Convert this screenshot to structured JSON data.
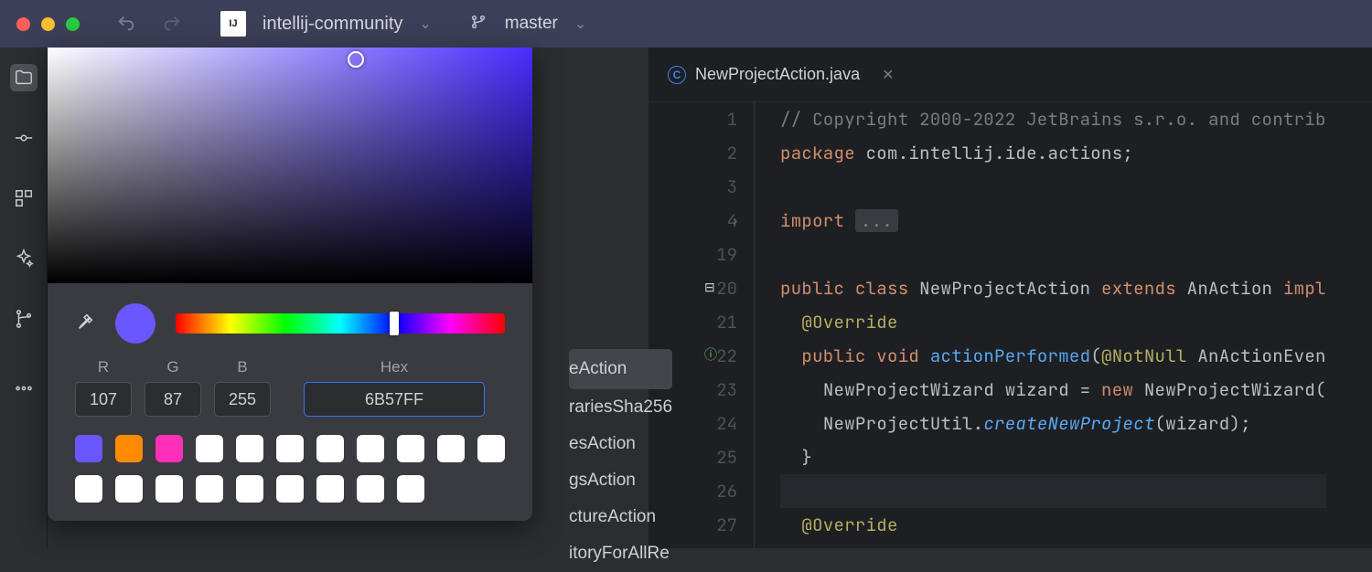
{
  "titlebar": {
    "project_name": "intellij-community",
    "branch_name": "master"
  },
  "rail": {
    "items": [
      "project",
      "commit",
      "structure",
      "ai",
      "git",
      "more"
    ]
  },
  "color_picker": {
    "labels": {
      "r": "R",
      "g": "G",
      "b": "B",
      "hex": "Hex"
    },
    "values": {
      "r": "107",
      "g": "87",
      "b": "255",
      "hex": "6B57FF"
    },
    "selected_color": "#6b57ff",
    "palette_row1": [
      "#6b57ff",
      "#ff8a00",
      "#ff2fb9",
      "#ffffff",
      "#ffffff",
      "#ffffff",
      "#ffffff",
      "#ffffff",
      "#ffffff",
      "#ffffff"
    ],
    "palette_row2": [
      "#ffffff",
      "#ffffff",
      "#ffffff",
      "#ffffff",
      "#ffffff",
      "#ffffff",
      "#ffffff",
      "#ffffff",
      "#ffffff",
      "#ffffff"
    ]
  },
  "peek_items": [
    "eAction",
    "rariesSha256",
    "esAction",
    "gsAction",
    "ctureAction",
    "itoryForAllRe"
  ],
  "editor": {
    "tab_name": "NewProjectAction.java",
    "lines": [
      {
        "num": "1",
        "type": "comment",
        "text": "// Copyright 2000-2022 JetBrains s.r.o. and contrib"
      },
      {
        "num": "2",
        "type": "package",
        "kw": "package",
        "rest": " com.intellij.ide.actions;"
      },
      {
        "num": "3",
        "type": "blank"
      },
      {
        "num": "4",
        "type": "import",
        "kw": "import",
        "fold": "..."
      },
      {
        "num": "19",
        "type": "blank"
      },
      {
        "num": "20",
        "type": "class",
        "tokens": [
          "public",
          " class ",
          "NewProjectAction",
          " extends ",
          "AnAction",
          " impl"
        ]
      },
      {
        "num": "21",
        "type": "ann",
        "text": "@Override"
      },
      {
        "num": "22",
        "type": "method",
        "tokens": [
          "public",
          " void ",
          "actionPerformed",
          "(",
          "@NotNull",
          " AnActionEven"
        ]
      },
      {
        "num": "23",
        "type": "body1",
        "t1": "NewProjectWizard wizard = ",
        "kw": "new",
        "t2": " NewProjectWizard("
      },
      {
        "num": "24",
        "type": "body2",
        "t1": "NewProjectUtil.",
        "fn": "createNewProject",
        "t2": "(wizard);"
      },
      {
        "num": "25",
        "type": "brace",
        "text": "}"
      },
      {
        "num": "26",
        "type": "blank-hl"
      },
      {
        "num": "27",
        "type": "ann",
        "text": "@Override"
      }
    ]
  }
}
